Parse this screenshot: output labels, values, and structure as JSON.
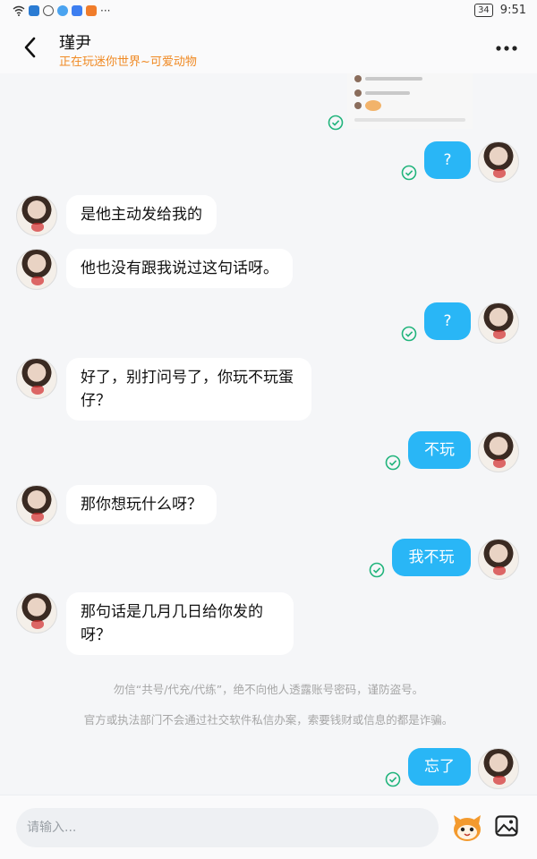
{
  "status_bar": {
    "battery": "34",
    "time": "9:51"
  },
  "header": {
    "name": "瑾尹",
    "status": "正在玩迷你世界~可爱动物"
  },
  "messages": [
    {
      "text": "?"
    },
    {
      "text": "是他主动发给我的"
    },
    {
      "text": "他也没有跟我说过这句话呀。"
    },
    {
      "text": "?"
    },
    {
      "text": "好了，别打问号了，你玩不玩蛋仔？"
    },
    {
      "text": "不玩"
    },
    {
      "text": "那你想玩什么呀？"
    },
    {
      "text": "我不玩"
    },
    {
      "text": "那句话是几月几日给你发的呀？"
    },
    {
      "text": "忘了"
    }
  ],
  "notices": [
    "勿信“共号/代充/代练”，绝不向他人透露账号密码，谨防盗号。",
    "官方或执法部门不会通过社交软件私信办案，索要钱财或信息的都是诈骗。"
  ],
  "input": {
    "placeholder": "请输入..."
  },
  "colors": {
    "accent": "#29b6f6",
    "status": "#f08a24",
    "check": "#21b47c"
  }
}
